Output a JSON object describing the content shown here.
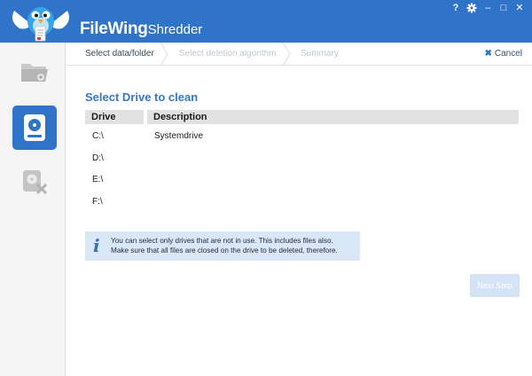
{
  "app": {
    "name_part1": "FileWing",
    "name_part2": "Shredder"
  },
  "window_controls": {
    "help": "?",
    "settings_icon": "gear-icon",
    "minimize": "–",
    "maximize": "□",
    "close": "✕"
  },
  "sidebar": {
    "items": [
      {
        "name": "shred-files-folders",
        "icon": "folder-icon",
        "active": false
      },
      {
        "name": "shred-drive",
        "icon": "hard-drive-icon",
        "active": true
      },
      {
        "name": "wipe-free-space",
        "icon": "drive-delete-icon",
        "active": false
      }
    ]
  },
  "steps": {
    "items": [
      {
        "label": "Select data/folder",
        "state": "current"
      },
      {
        "label": "Select deletion algorithm",
        "state": "future"
      },
      {
        "label": "Summary",
        "state": "future"
      }
    ],
    "cancel_label": "Cancel"
  },
  "main": {
    "heading": "Select Drive to clean",
    "columns": {
      "drive": "Drive",
      "description": "Description"
    },
    "drives": [
      {
        "drive": "C:\\",
        "description": "Systemdrive"
      },
      {
        "drive": "D:\\",
        "description": ""
      },
      {
        "drive": "E:\\",
        "description": ""
      },
      {
        "drive": "F:\\",
        "description": ""
      }
    ],
    "info_line1": "You can select only drives that are not in use. This includes files also.",
    "info_line2": "Make sure that all files are closed on the drive to be deleted, therefore.",
    "next_label": "Next Step"
  },
  "colors": {
    "accent": "#2f74c9",
    "heading": "#3577c4",
    "info_bg": "#dae7f7",
    "next_disabled": "#d4e3f5"
  }
}
